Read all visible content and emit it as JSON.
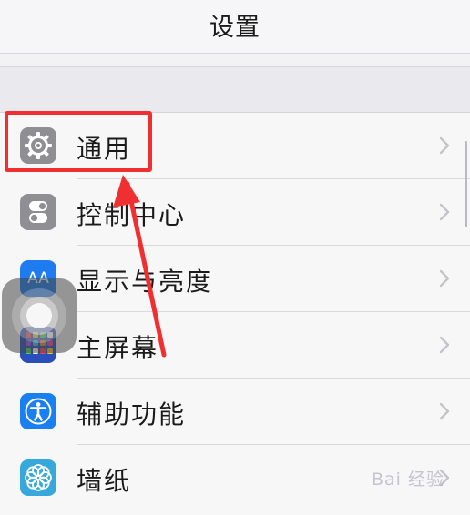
{
  "header": {
    "title": "设置"
  },
  "settings": [
    {
      "label": "通用",
      "icon": "gear-icon",
      "color": "#8e8e93"
    },
    {
      "label": "控制中心",
      "icon": "control-center-icon",
      "color": "#8e8e93"
    },
    {
      "label": "显示与亮度",
      "icon": "display-brightness-icon",
      "color": "#1e7cf0"
    },
    {
      "label": "主屏幕",
      "icon": "home-screen-icon",
      "color": "#2a4fb8"
    },
    {
      "label": "辅助功能",
      "icon": "accessibility-icon",
      "color": "#1a7ff0"
    },
    {
      "label": "墙纸",
      "icon": "wallpaper-icon",
      "color": "#36a8dc"
    }
  ],
  "display_icon_text": "AA",
  "annotation": {
    "highlight_color": "#f03030"
  },
  "watermark": {
    "text": "Bai 经验"
  }
}
